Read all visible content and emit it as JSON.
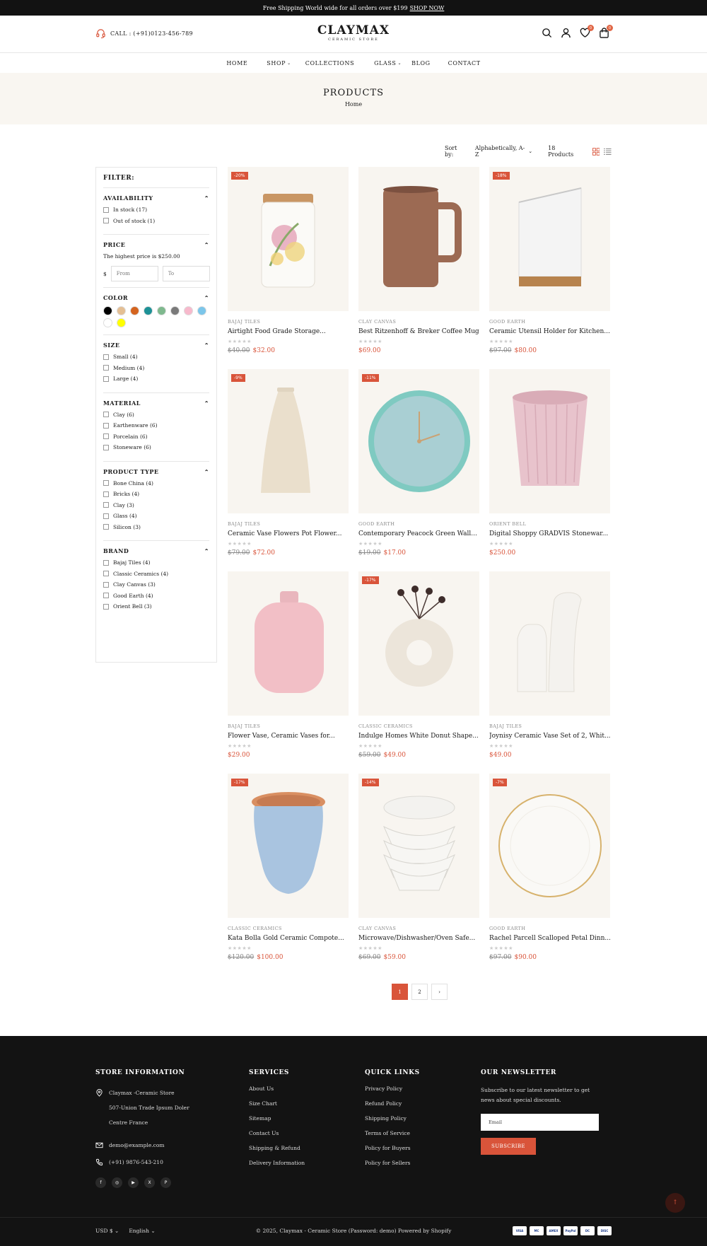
{
  "announcement": {
    "text": "Free Shipping World wide for all orders over $199",
    "link": "SHOP NOW"
  },
  "header": {
    "call": "CALL : (+91)0123-456-789",
    "logo_name": "CLAYMAX",
    "logo_sub": "CERAMIC STORE",
    "wishlist_count": "0",
    "cart_count": "0"
  },
  "nav": {
    "items": [
      "HOME",
      "SHOP",
      "COLLECTIONS",
      "GLASS",
      "BLOG",
      "CONTACT"
    ]
  },
  "banner": {
    "title": "PRODUCTS",
    "breadcrumb": "Home"
  },
  "toolbar": {
    "sort_label": "Sort by:",
    "sort_value": "Alphabetically, A-Z",
    "count": "18 Products"
  },
  "filter": {
    "heading": "FILTER:",
    "availability": {
      "title": "AVAILABILITY",
      "options": [
        "In stock (17)",
        "Out of stock (1)"
      ]
    },
    "price": {
      "title": "PRICE",
      "note": "The highest price is $250.00",
      "currency": "$",
      "from_placeholder": "From",
      "to_placeholder": "To"
    },
    "color": {
      "title": "COLOR",
      "swatches": [
        "#000000",
        "#e4bf94",
        "#d4641f",
        "#1d9196",
        "#7fb98e",
        "#7a7a7a",
        "#f7b9cc",
        "#7cc6ea",
        "#ffffff",
        "#ffff00"
      ]
    },
    "size": {
      "title": "SIZE",
      "options": [
        "Small (4)",
        "Medium (4)",
        "Large (4)"
      ]
    },
    "material": {
      "title": "MATERIAL",
      "options": [
        "Clay (6)",
        "Earthenware (6)",
        "Porcelain (6)",
        "Stoneware (6)"
      ]
    },
    "product_type": {
      "title": "PRODUCT TYPE",
      "options": [
        "Bone China (4)",
        "Bricks (4)",
        "Clay (3)",
        "Glass (4)",
        "Silicon (3)"
      ]
    },
    "brand": {
      "title": "BRAND",
      "options": [
        "Bajaj Tiles (4)",
        "Classic Ceramics (4)",
        "Clay Canvas (3)",
        "Good Earth (4)",
        "Orient Bell (3)"
      ]
    }
  },
  "products": [
    {
      "vendor": "BAJAJ TILES",
      "title": "Airtight Food Grade Storage...",
      "badge": "-20%",
      "compare": "$40.00",
      "price": "$32.00",
      "art": "jar"
    },
    {
      "vendor": "CLAY CANVAS",
      "title": "Best Ritzenhoff & Breker Coffee Mug",
      "badge": "",
      "compare": "",
      "price": "$69.00",
      "art": "mug"
    },
    {
      "vendor": "GOOD EARTH",
      "title": "Ceramic Utensil Holder for Kitchen...",
      "badge": "-18%",
      "compare": "$97.00",
      "price": "$80.00",
      "art": "holder"
    },
    {
      "vendor": "BAJAJ TILES",
      "title": "Ceramic Vase Flowers Pot Flower...",
      "badge": "-9%",
      "compare": "$79.00",
      "price": "$72.00",
      "art": "cone"
    },
    {
      "vendor": "GOOD EARTH",
      "title": "Contemporary Peacock Green Wall...",
      "badge": "-11%",
      "compare": "$19.00",
      "price": "$17.00",
      "art": "clock"
    },
    {
      "vendor": "ORIENT BELL",
      "title": "Digital Shoppy GRADVIS Stonewar...",
      "badge": "",
      "compare": "",
      "price": "$250.00",
      "art": "pot"
    },
    {
      "vendor": "BAJAJ TILES",
      "title": "Flower Vase, Ceramic Vases for...",
      "badge": "",
      "compare": "",
      "price": "$29.00",
      "art": "pinkvase"
    },
    {
      "vendor": "CLASSIC CERAMICS",
      "title": "Indulge Homes White Donut Shape...",
      "badge": "-17%",
      "compare": "$59.00",
      "price": "$49.00",
      "art": "donut"
    },
    {
      "vendor": "BAJAJ TILES",
      "title": "Joynisy Ceramic Vase Set of 2, Whit...",
      "badge": "",
      "compare": "",
      "price": "$49.00",
      "art": "twovase"
    },
    {
      "vendor": "CLASSIC CERAMICS",
      "title": "Kata Bolla Gold Ceramic Compote...",
      "badge": "-17%",
      "compare": "$120.00",
      "price": "$100.00",
      "art": "bluepot"
    },
    {
      "vendor": "CLAY CANVAS",
      "title": "Microwave/Dishwasher/Oven Safe...",
      "badge": "-14%",
      "compare": "$69.00",
      "price": "$59.00",
      "art": "bowls"
    },
    {
      "vendor": "GOOD EARTH",
      "title": "Rachel Parcell Scalloped Petal Dinn...",
      "badge": "-7%",
      "compare": "$97.00",
      "price": "$90.00",
      "art": "plate"
    }
  ],
  "pagination": {
    "pages": [
      "1",
      "2"
    ],
    "next": "›"
  },
  "footer": {
    "store": {
      "title": "STORE INFORMATION",
      "name": "Claymax -Ceramic Store",
      "addr1": "507-Union Trade Ipsum Doler",
      "addr2": "Centre France",
      "email": "demo@example.com",
      "phone": "(+91) 9876-543-210"
    },
    "services": {
      "title": "SERVICES",
      "links": [
        "About Us",
        "Size Chart",
        "Sitemap",
        "Contact Us",
        "Shipping & Refund",
        "Delivery Information"
      ]
    },
    "quick": {
      "title": "QUICK LINKS",
      "links": [
        "Privacy Policy",
        "Refund Policy",
        "Shipping Policy",
        "Terms of Service",
        "Policy for Buyers",
        "Policy for Sellers"
      ]
    },
    "newsletter": {
      "title": "OUR NEWSLETTER",
      "text": "Subscribe to our latest newsletter to get news about special discounts.",
      "placeholder": "Email",
      "button": "SUBSCRIBE"
    },
    "currency": "USD $",
    "language": "English",
    "copyright": "© 2025, Claymax - Ceramic Store (Password: demo) Powered by Shopify",
    "payments": [
      "VISA",
      "MC",
      "AMEX",
      "PayPal",
      "DC",
      "DISC"
    ]
  }
}
